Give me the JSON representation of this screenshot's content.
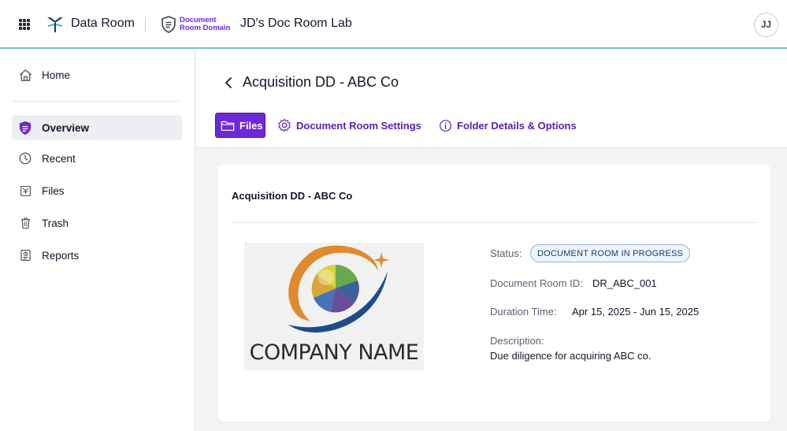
{
  "header": {
    "brand_name": "Data Room",
    "domain_line1": "Document",
    "domain_line2": "Room Domain",
    "room_title": "JD's Doc Room Lab",
    "avatar_initials": "JJ",
    "accent_color": "#6d28d9"
  },
  "sidebar": {
    "items": [
      {
        "label": "Home",
        "icon": "home-icon"
      },
      {
        "label": "Overview",
        "icon": "shield-icon",
        "active": true
      },
      {
        "label": "Recent",
        "icon": "clock-icon"
      },
      {
        "label": "Files",
        "icon": "files-icon"
      },
      {
        "label": "Trash",
        "icon": "trash-icon"
      },
      {
        "label": "Reports",
        "icon": "reports-icon"
      }
    ]
  },
  "main": {
    "page_title": "Acquisition DD - ABC Co",
    "tabs": [
      {
        "label": "Files",
        "icon": "folder-icon",
        "active": true
      },
      {
        "label": "Document Room Settings",
        "icon": "gear-icon"
      },
      {
        "label": "Folder Details & Options",
        "icon": "info-icon"
      }
    ],
    "card": {
      "title": "Acquisition DD - ABC Co",
      "logo_text": "COMPANY NAME",
      "status_label": "Status:",
      "status_value": "DOCUMENT ROOM IN PROGRESS",
      "room_id_label": "Document Room ID:",
      "room_id_value": "DR_ABC_001",
      "duration_label": "Duration Time:",
      "duration_value": "Apr 15, 2025 - Jun 15, 2025",
      "description_label": "Description:",
      "description_value": "Due diligence for acquiring ABC co."
    }
  }
}
